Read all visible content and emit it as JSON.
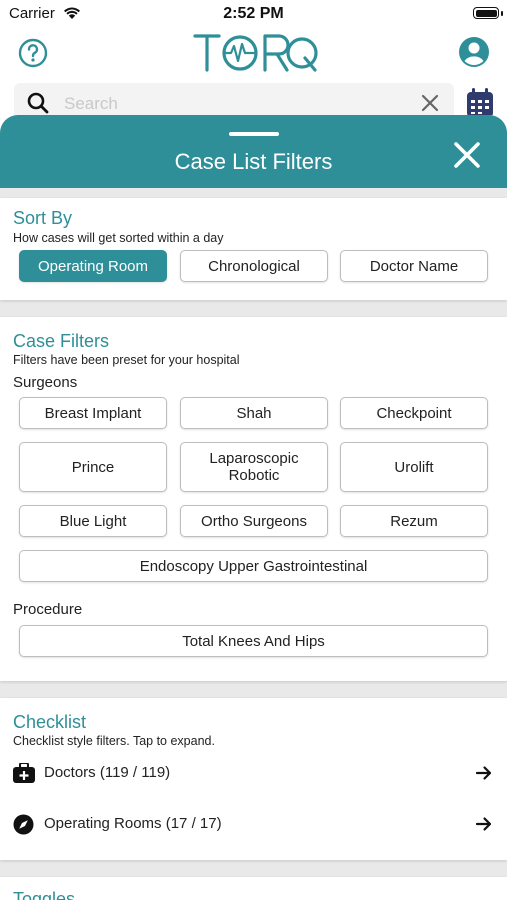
{
  "status_bar": {
    "carrier": "Carrier",
    "time": "2:52 PM"
  },
  "header": {
    "logo_text": "TORQ"
  },
  "search": {
    "placeholder": "Search",
    "value": ""
  },
  "colors": {
    "accent": "#2e8f98",
    "sheet_bg": "#e9e9e9"
  },
  "sheet": {
    "title": "Case List Filters"
  },
  "sort_by": {
    "title": "Sort By",
    "subtitle": "How cases will get sorted within a day",
    "options": [
      "Operating Room",
      "Chronological",
      "Doctor Name"
    ],
    "selected": "Operating Room"
  },
  "case_filters": {
    "title": "Case Filters",
    "subtitle": "Filters have been preset for your hospital",
    "surgeons_label": "Surgeons",
    "surgeons": [
      "Breast Implant",
      "Shah",
      "Checkpoint",
      "Prince",
      "Laparoscopic Robotic",
      "Urolift",
      "Blue Light",
      "Ortho Surgeons",
      "Rezum",
      "Endoscopy Upper Gastrointestinal"
    ],
    "procedure_label": "Procedure",
    "procedures": [
      "Total Knees And Hips"
    ]
  },
  "checklist": {
    "title": "Checklist",
    "subtitle": "Checklist style filters. Tap to expand.",
    "items": [
      {
        "label": "Doctors (119 / 119)",
        "icon": "medical-bag-icon"
      },
      {
        "label": "Operating Rooms (17 / 17)",
        "icon": "compass-icon"
      }
    ]
  },
  "toggles": {
    "title": "Toggles"
  }
}
